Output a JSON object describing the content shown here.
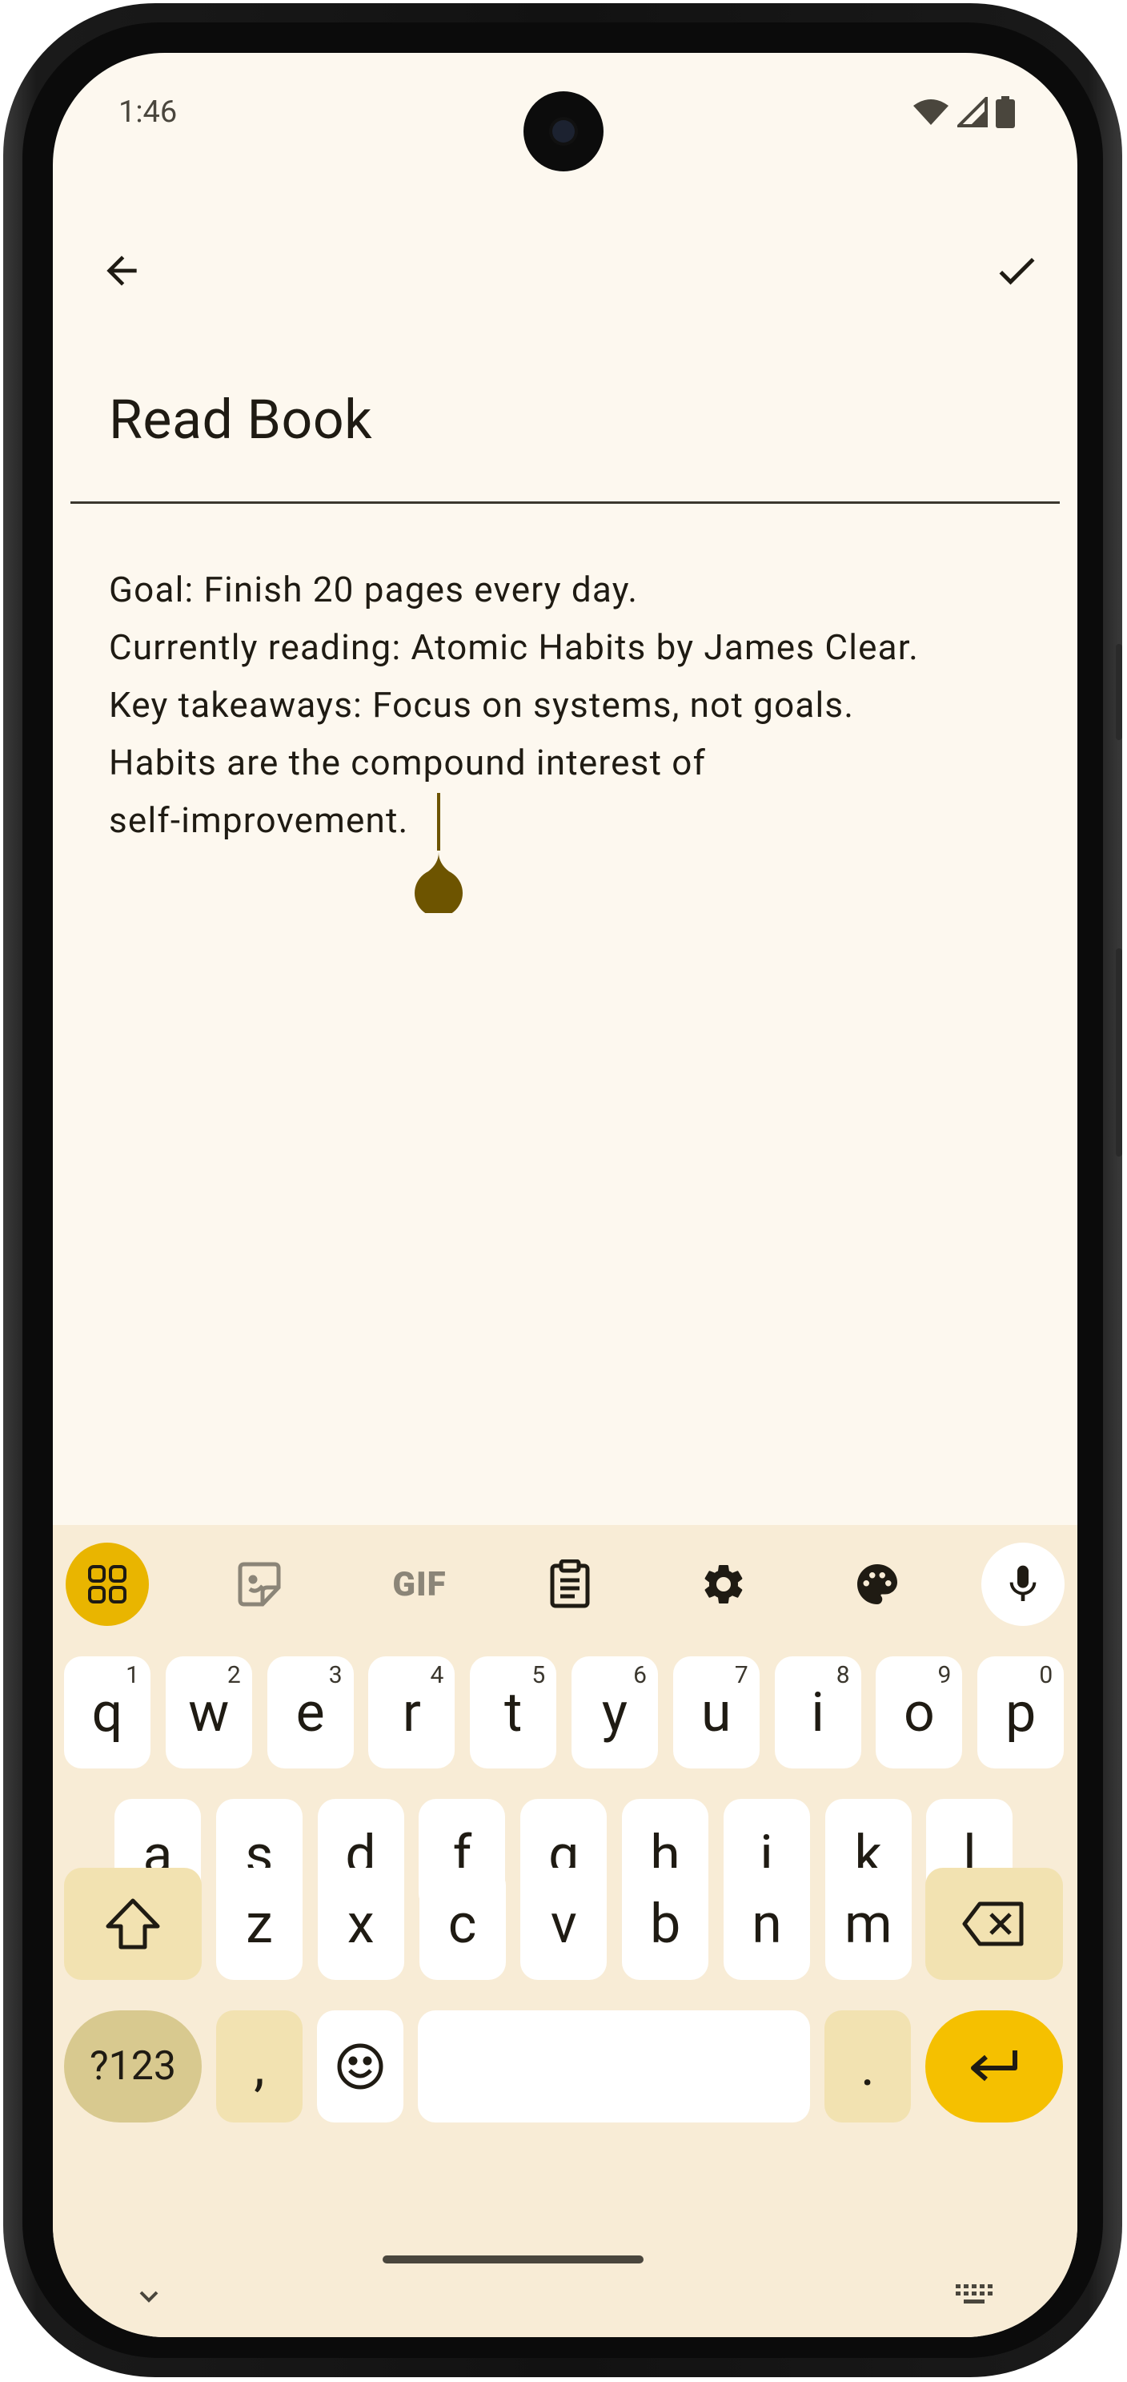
{
  "status_bar": {
    "time": "1:46"
  },
  "app_bar": {
    "back_icon": "arrow-back-icon",
    "save_icon": "check-icon"
  },
  "note": {
    "title": "Read Book",
    "body_lines": [
      "Goal: Finish 20 pages every day.",
      "Currently reading: Atomic Habits by James Clear.",
      "Key takeaways: Focus on systems, not goals.",
      "Habits are the compound interest of",
      "self-improvement."
    ]
  },
  "keyboard": {
    "toolbar": [
      "apps-grid-icon",
      "sticker-icon",
      "gif-icon",
      "clipboard-icon",
      "settings-icon",
      "palette-icon",
      "mic-icon"
    ],
    "gif_label": "GIF",
    "row1": [
      {
        "key": "q",
        "hint": "1"
      },
      {
        "key": "w",
        "hint": "2"
      },
      {
        "key": "e",
        "hint": "3"
      },
      {
        "key": "r",
        "hint": "4"
      },
      {
        "key": "t",
        "hint": "5"
      },
      {
        "key": "y",
        "hint": "6"
      },
      {
        "key": "u",
        "hint": "7"
      },
      {
        "key": "i",
        "hint": "8"
      },
      {
        "key": "o",
        "hint": "9"
      },
      {
        "key": "p",
        "hint": "0"
      }
    ],
    "row2": [
      "a",
      "s",
      "d",
      "f",
      "g",
      "h",
      "j",
      "k",
      "l"
    ],
    "row3": [
      "z",
      "x",
      "c",
      "v",
      "b",
      "n",
      "m"
    ],
    "symbols_label": "?123",
    "comma_label": ",",
    "period_label": ".",
    "colors": {
      "background": "#f8ecd6",
      "accent": "#f5c000",
      "modifier": "#f2e2b1",
      "symbols": "#d8c98f",
      "key": "#ffffff"
    }
  }
}
